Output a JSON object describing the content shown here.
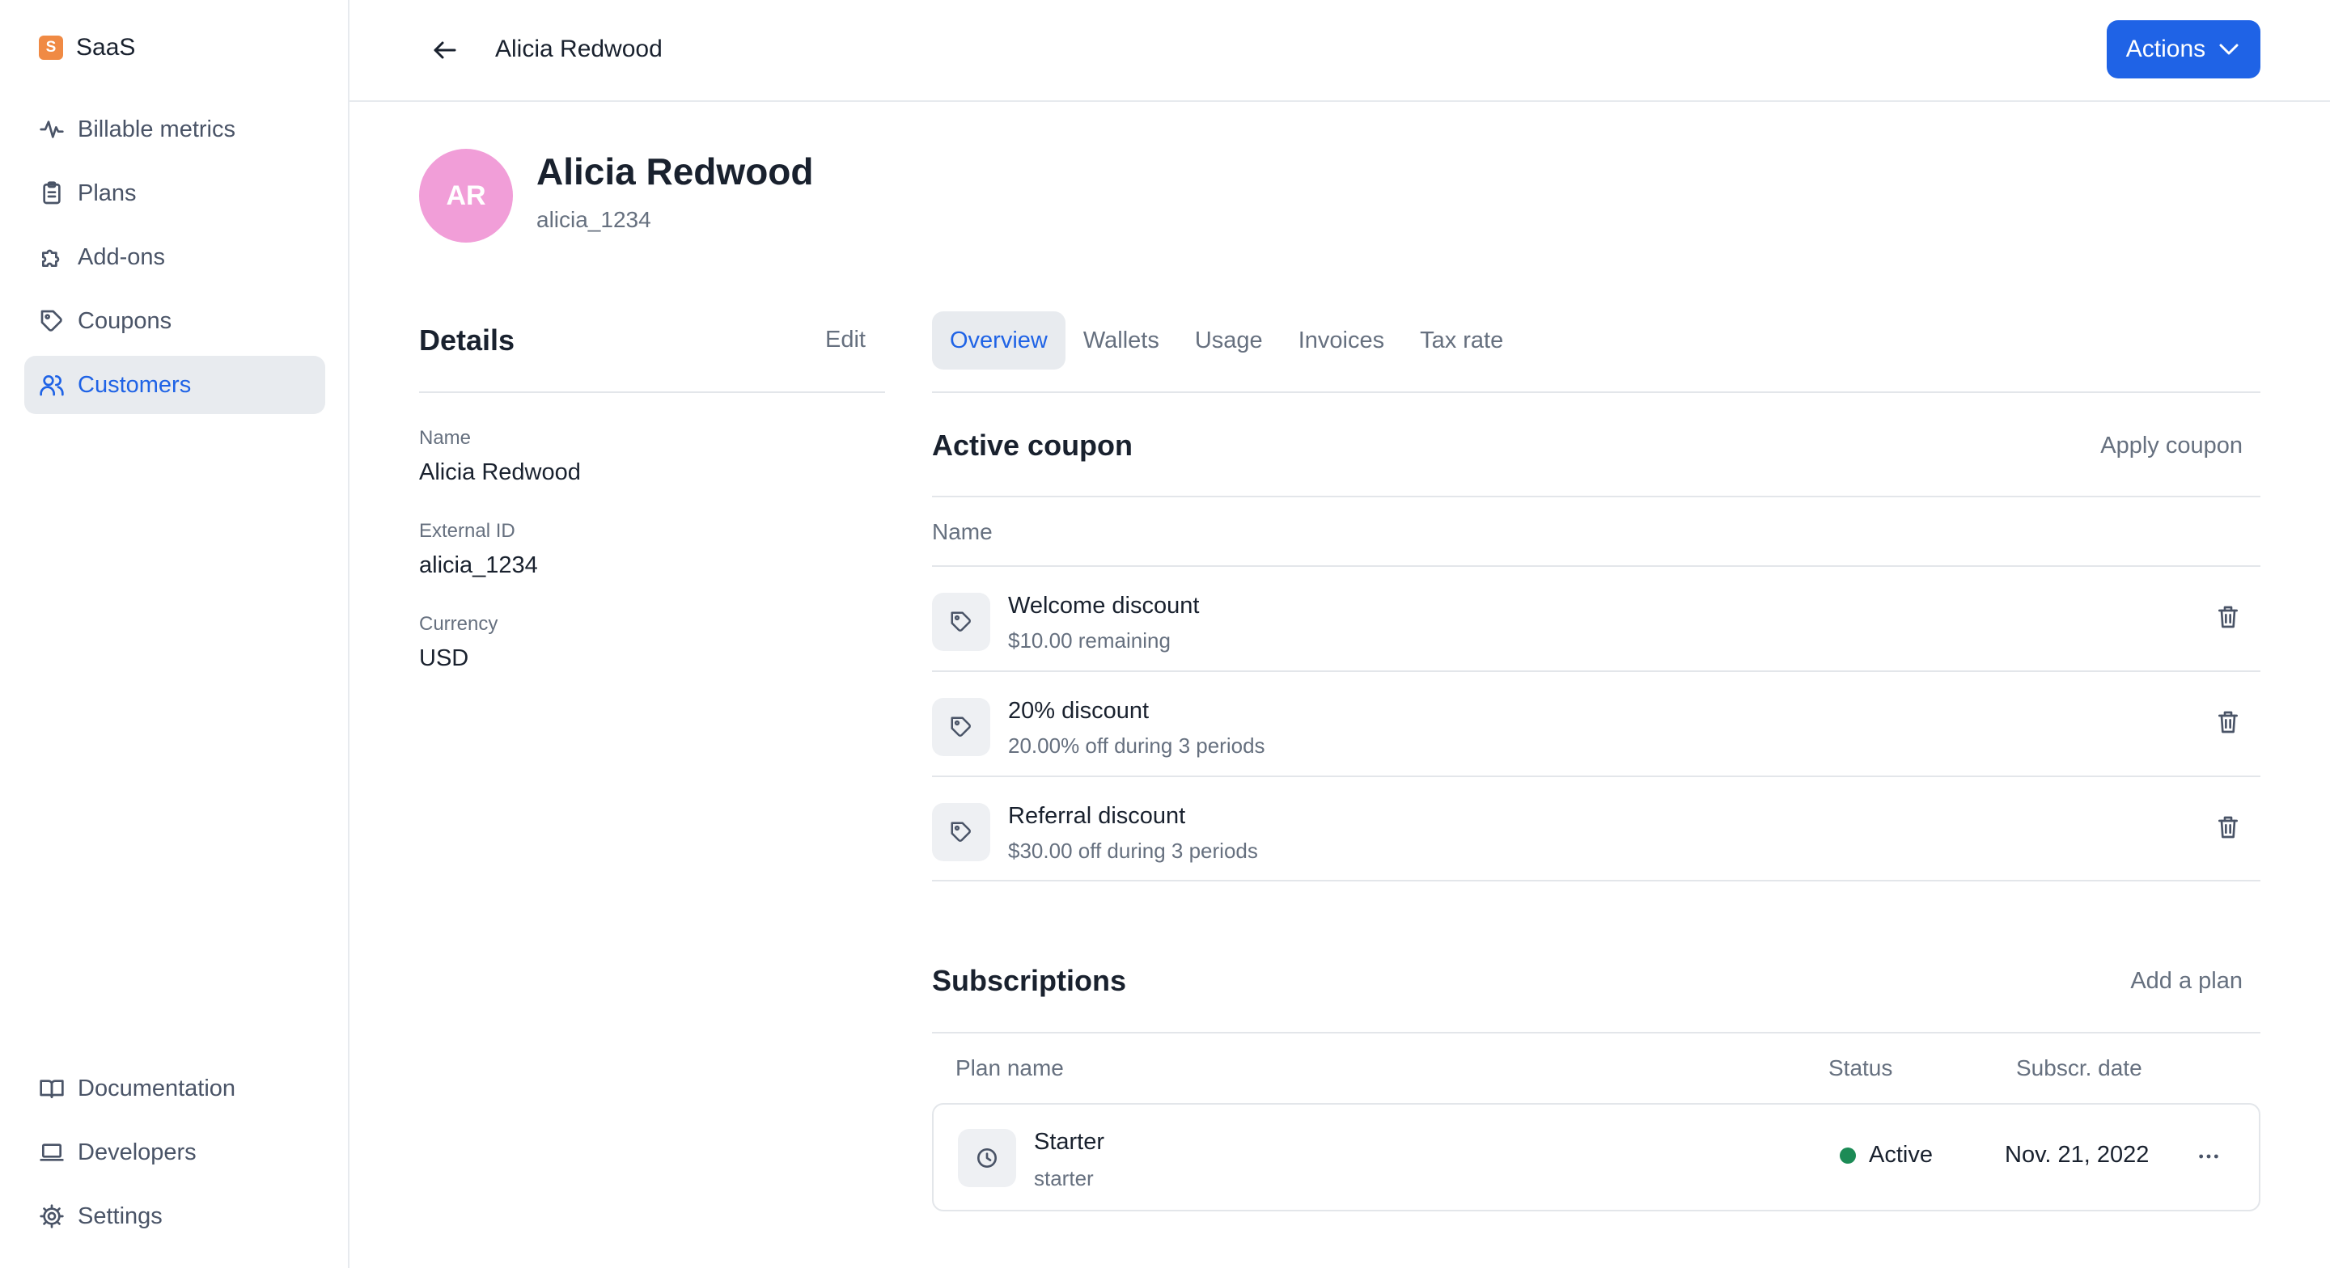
{
  "sidebar": {
    "brand": {
      "logo_letter": "S",
      "name": "SaaS",
      "logo_color": "#f08a44"
    },
    "items": [
      {
        "label": "Billable metrics",
        "icon": "pulse-icon"
      },
      {
        "label": "Plans",
        "icon": "clipboard-icon"
      },
      {
        "label": "Add-ons",
        "icon": "puzzle-icon"
      },
      {
        "label": "Coupons",
        "icon": "tag-icon"
      },
      {
        "label": "Customers",
        "icon": "users-icon",
        "active": true
      }
    ],
    "bottom_items": [
      {
        "label": "Documentation",
        "icon": "book-icon"
      },
      {
        "label": "Developers",
        "icon": "laptop-icon"
      },
      {
        "label": "Settings",
        "icon": "gear-icon"
      }
    ]
  },
  "topbar": {
    "title": "Alicia Redwood",
    "actions_label": "Actions",
    "accent": "#1f63e6"
  },
  "customer": {
    "initials": "AR",
    "name": "Alicia Redwood",
    "external_id": "alicia_1234",
    "avatar_color": "#f19ed8"
  },
  "details": {
    "title": "Details",
    "edit_label": "Edit",
    "fields": [
      {
        "label": "Name",
        "value": "Alicia Redwood"
      },
      {
        "label": "External ID",
        "value": "alicia_1234"
      },
      {
        "label": "Currency",
        "value": "USD"
      }
    ]
  },
  "tabs": [
    {
      "label": "Overview",
      "active": true
    },
    {
      "label": "Wallets"
    },
    {
      "label": "Usage"
    },
    {
      "label": "Invoices"
    },
    {
      "label": "Tax rate"
    }
  ],
  "coupons": {
    "title": "Active coupon",
    "action": "Apply coupon",
    "column": "Name",
    "rows": [
      {
        "name": "Welcome discount",
        "desc": "$10.00 remaining"
      },
      {
        "name": "20% discount",
        "desc": "20.00% off during 3 periods"
      },
      {
        "name": "Referral discount",
        "desc": "$30.00 off during 3 periods"
      }
    ]
  },
  "subscriptions": {
    "title": "Subscriptions",
    "action": "Add a plan",
    "columns": {
      "plan": "Plan name",
      "status": "Status",
      "date": "Subscr. date"
    },
    "rows": [
      {
        "name": "Starter",
        "code": "starter",
        "status": "Active",
        "status_color": "#1c8b56",
        "date": "Nov. 21, 2022"
      }
    ]
  }
}
